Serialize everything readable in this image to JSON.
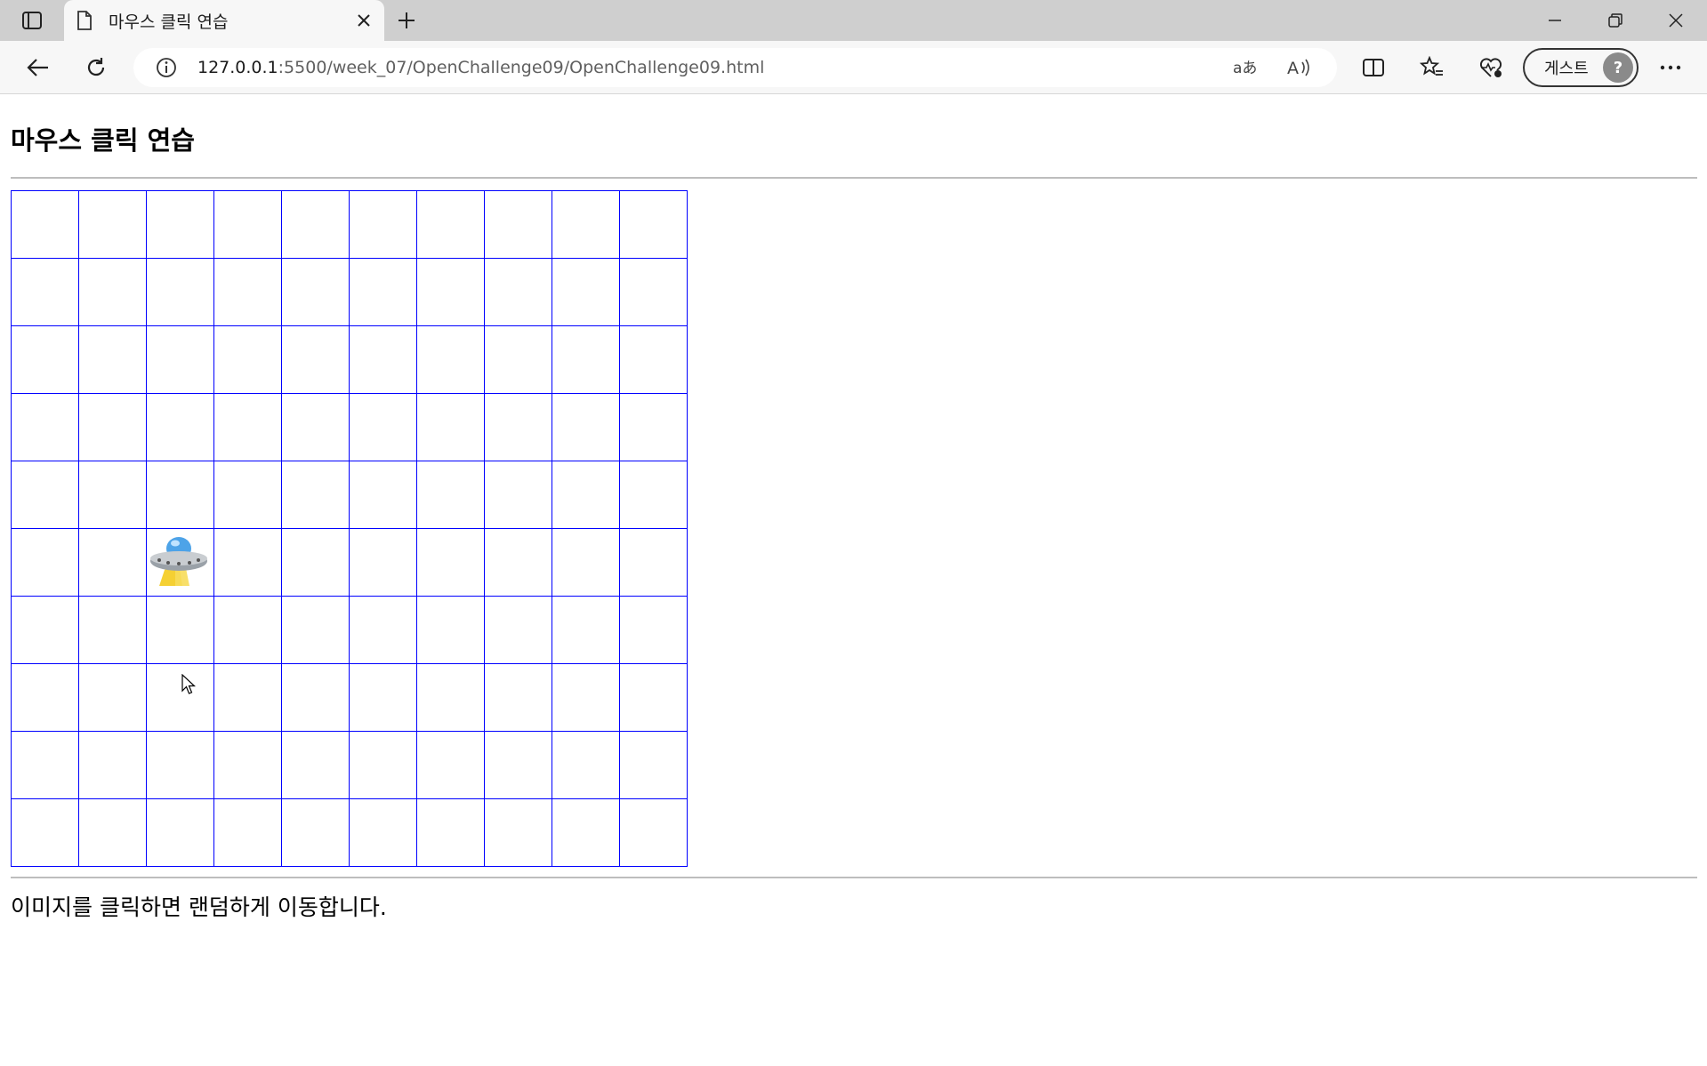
{
  "browser": {
    "tab": {
      "title": "마우스 클릭 연습"
    },
    "address_bar": {
      "host": "127.0.0.1",
      "path": ":5500/week_07/OpenChallenge09/OpenChallenge09.html"
    },
    "profile": {
      "label": "게스트"
    }
  },
  "page": {
    "title": "마우스 클릭 연습",
    "grid": {
      "rows": 10,
      "cols": 10,
      "image_row": 5,
      "image_col": 2,
      "border_color": "#0000ff"
    },
    "image": {
      "name": "ufo"
    },
    "instructions": "이미지를 클릭하면 랜덤하게 이동합니다."
  }
}
